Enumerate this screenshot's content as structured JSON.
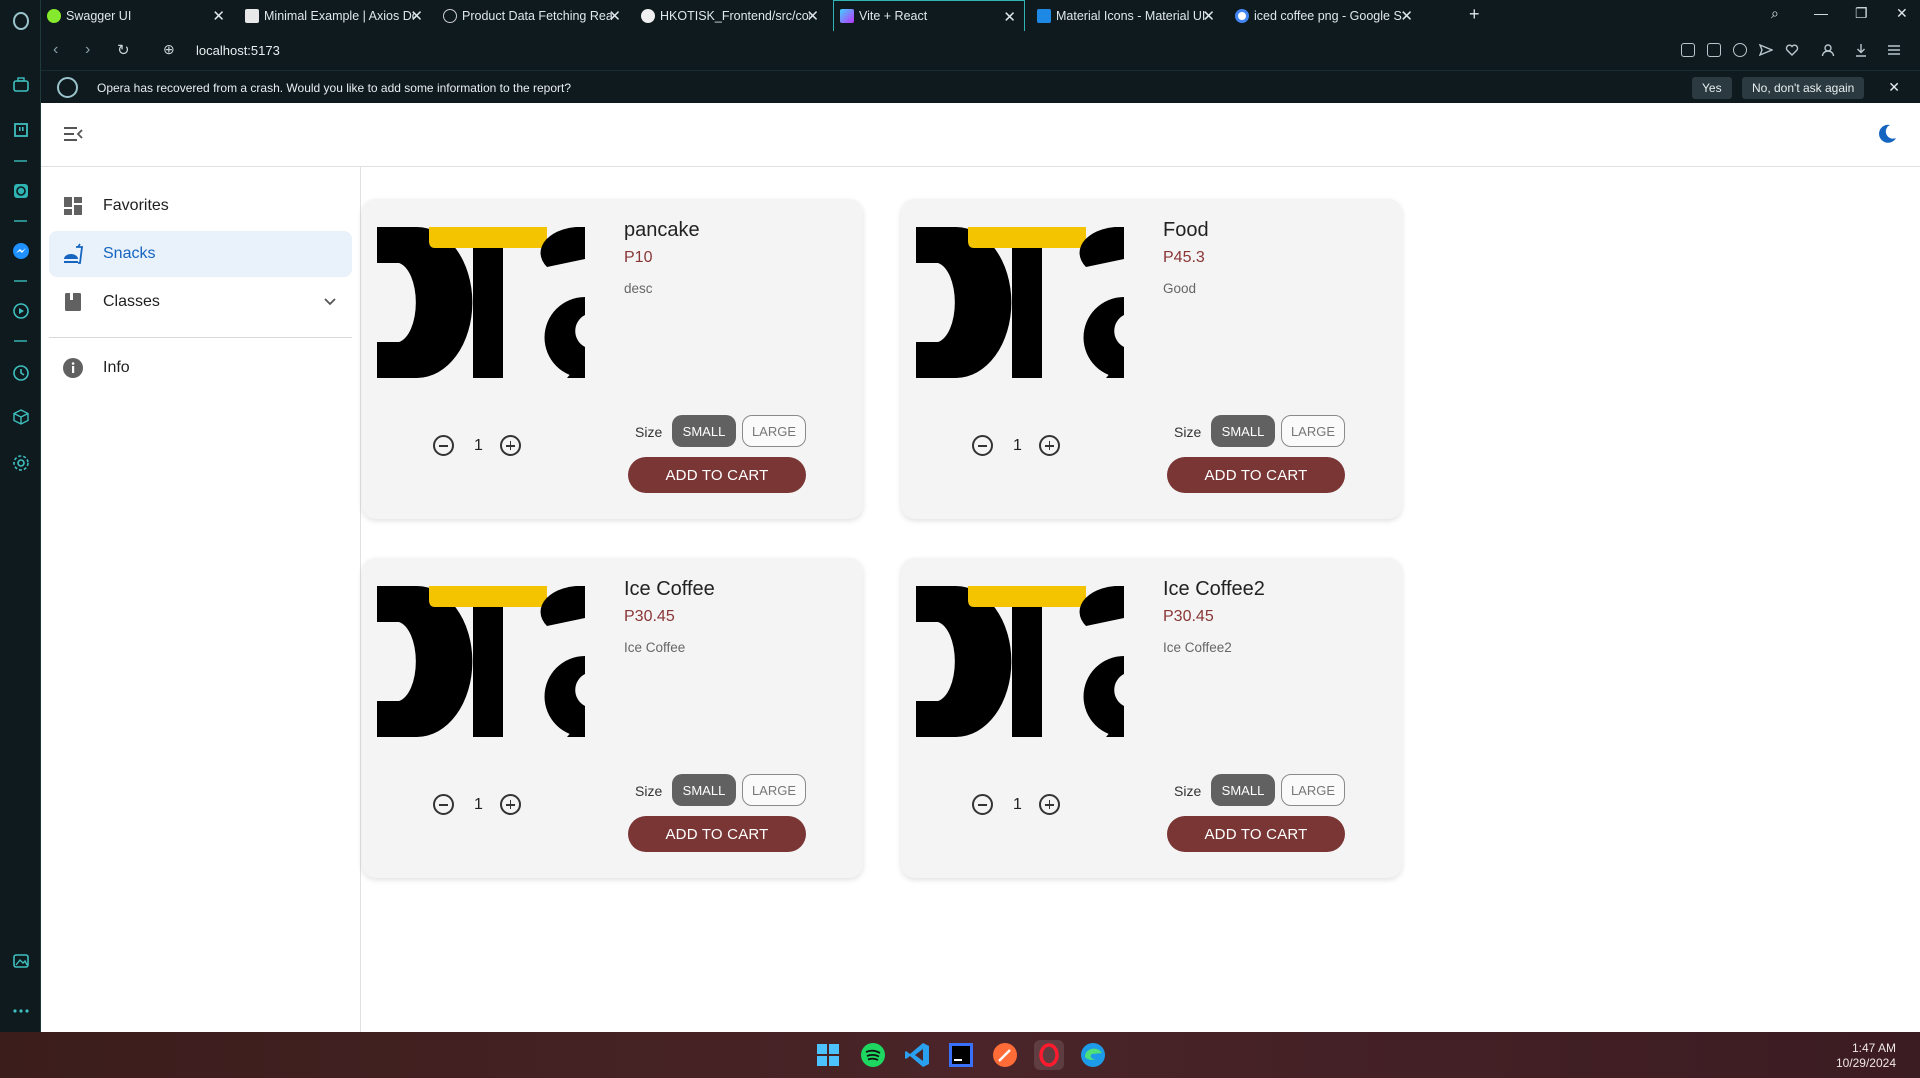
{
  "browser": {
    "tabs": [
      {
        "title": "Swagger UI",
        "active": false
      },
      {
        "title": "Minimal Example | Axios Do",
        "active": false
      },
      {
        "title": "Product Data Fetching Reac",
        "active": false
      },
      {
        "title": "HKOTISK_Frontend/src/com",
        "active": false
      },
      {
        "title": "Vite + React",
        "active": true
      },
      {
        "title": "Material Icons - Material UI",
        "active": false
      },
      {
        "title": "iced coffee png - Google S",
        "active": false
      }
    ],
    "url": "localhost:5173",
    "infobar": {
      "message": "Opera has recovered from a crash. Would you like to add some information to the report?",
      "yes_label": "Yes",
      "no_label": "No, don't ask again"
    }
  },
  "drawer": {
    "items": [
      {
        "label": "Favorites",
        "icon": "dashboard-icon",
        "selected": false
      },
      {
        "label": "Snacks",
        "icon": "fastfood-icon",
        "selected": true
      },
      {
        "label": "Classes",
        "icon": "book-icon",
        "selected": false,
        "expandable": true
      },
      {
        "label": "Info",
        "icon": "info-icon",
        "selected": false
      }
    ]
  },
  "products": [
    {
      "name": "pancake",
      "price": "P10",
      "desc": "desc",
      "qty": "1",
      "size_label": "Size",
      "small_label": "SMALL",
      "large_label": "LARGE",
      "cart_label": "ADD TO CART"
    },
    {
      "name": "Food",
      "price": "P45.3",
      "desc": "Good",
      "qty": "1",
      "size_label": "Size",
      "small_label": "SMALL",
      "large_label": "LARGE",
      "cart_label": "ADD TO CART"
    },
    {
      "name": "Ice Coffee",
      "price": "P30.45",
      "desc": "Ice Coffee",
      "qty": "1",
      "size_label": "Size",
      "small_label": "SMALL",
      "large_label": "LARGE",
      "cart_label": "ADD TO CART"
    },
    {
      "name": "Ice Coffee2",
      "price": "P30.45",
      "desc": "Ice Coffee2",
      "qty": "1",
      "size_label": "Size",
      "small_label": "SMALL",
      "large_label": "LARGE",
      "cart_label": "ADD TO CART"
    }
  ],
  "taskbar": {
    "time": "1:47 AM",
    "date": "10/29/2024"
  },
  "colors": {
    "accent": "#1565c0",
    "price": "#8a3636",
    "cart_button": "#7a3535",
    "size_selected": "#616161",
    "browser_chrome": "#0e1a1e"
  }
}
